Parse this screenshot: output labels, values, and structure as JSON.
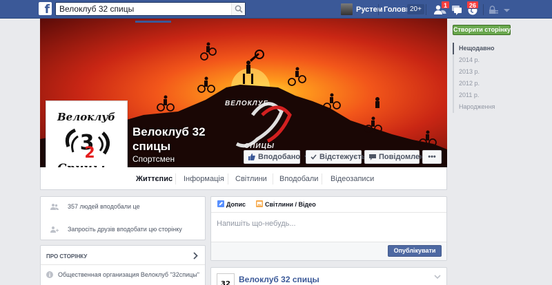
{
  "topbar": {
    "search_value": "Велоклуб 32 спицы",
    "user_name": "Рустем",
    "home_label": "Головна",
    "home_count": "20+",
    "friend_requests_count": "1",
    "notifications_count": "26"
  },
  "page": {
    "name": "Велоклуб 32 спицы",
    "category": "Спортсмен",
    "logo_text_top": "Велоклуб",
    "logo_text_bottom": "Спицы",
    "logo_number": "32",
    "cover_logo_text": "ВЕЛОКЛУБ",
    "cover_logo_sub": "СПИЦЫ"
  },
  "cover_buttons": {
    "liked": "Вподобано",
    "following": "Відстежується",
    "message": "Повідомлення",
    "more": "•••"
  },
  "tabs": [
    "Життєпис",
    "Інформація",
    "Світлини",
    "Вподобали",
    "Відеозаписи"
  ],
  "sidebar": {
    "create_page": "Створити сторінку",
    "years": [
      "Нещодавно",
      "2014 р.",
      "2013 р.",
      "2012 р.",
      "2011 р.",
      "Народження"
    ]
  },
  "left": {
    "likes_text": "357 людей вподобали це",
    "invite_text": "Запросіть друзів вподобати цю сторінку",
    "about_title": "ПРО СТОРІНКУ",
    "about_desc": "Общественная организация Велоклуб \"32спицы\""
  },
  "composer": {
    "tab_post": "Допис",
    "tab_photo": "Світлини / Відео",
    "placeholder": "Напишіть що-небудь...",
    "publish": "Опублікувати"
  },
  "post": {
    "author": "Велоклуб 32 спицы"
  },
  "colors": {
    "brand_blue": "#3b5998",
    "create_green": "#69a74e",
    "badge_red": "#fa3e3e"
  }
}
